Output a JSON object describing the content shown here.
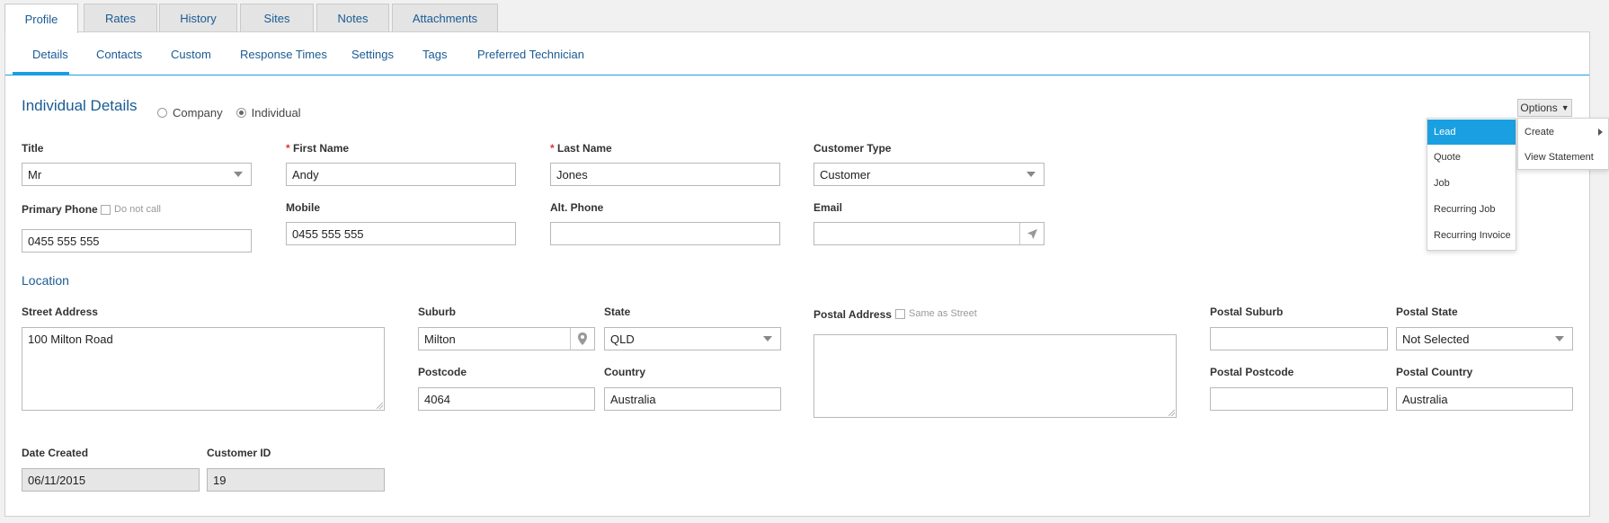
{
  "top_tabs": [
    {
      "label": "Profile"
    },
    {
      "label": "Rates"
    },
    {
      "label": "History"
    },
    {
      "label": "Sites"
    },
    {
      "label": "Notes"
    },
    {
      "label": "Attachments"
    }
  ],
  "sub_tabs": [
    {
      "label": "Details"
    },
    {
      "label": "Contacts"
    },
    {
      "label": "Custom"
    },
    {
      "label": "Response Times"
    },
    {
      "label": "Settings"
    },
    {
      "label": "Tags"
    },
    {
      "label": "Preferred Technician"
    }
  ],
  "details": {
    "title": "Individual Details",
    "type_company": "Company",
    "type_individual": "Individual",
    "selected_type": "Individual"
  },
  "fields": {
    "title_label": "Title",
    "title_value": "Mr",
    "first_name_label": "First Name",
    "first_name_value": "Andy",
    "last_name_label": "Last Name",
    "last_name_value": "Jones",
    "customer_type_label": "Customer Type",
    "customer_type_value": "Customer",
    "primary_phone_label": "Primary Phone",
    "do_not_call_label": "Do not call",
    "primary_phone_value": "0455 555 555",
    "mobile_label": "Mobile",
    "mobile_value": "0455 555 555",
    "alt_phone_label": "Alt. Phone",
    "alt_phone_value": "",
    "email_label": "Email",
    "email_value": "",
    "required_marker": "*"
  },
  "location": {
    "title": "Location",
    "street_label": "Street Address",
    "street_value": "100 Milton Road",
    "suburb_label": "Suburb",
    "suburb_value": "Milton",
    "state_label": "State",
    "state_value": "QLD",
    "postcode_label": "Postcode",
    "postcode_value": "4064",
    "country_label": "Country",
    "country_value": "Australia",
    "postal_address_label": "Postal Address",
    "same_as_street_label": "Same as Street",
    "postal_address_value": "",
    "postal_suburb_label": "Postal Suburb",
    "postal_suburb_value": "",
    "postal_state_label": "Postal State",
    "postal_state_value": "Not Selected",
    "postal_postcode_label": "Postal Postcode",
    "postal_postcode_value": "",
    "postal_country_label": "Postal Country",
    "postal_country_value": "Australia"
  },
  "meta": {
    "date_created_label": "Date Created",
    "date_created_value": "06/11/2015",
    "customer_id_label": "Customer ID",
    "customer_id_value": "19"
  },
  "options": {
    "button_label": "Options",
    "menu_items": [
      {
        "label": "Lead"
      },
      {
        "label": "Quote"
      },
      {
        "label": "Job"
      },
      {
        "label": "Recurring Job"
      },
      {
        "label": "Recurring Invoice"
      }
    ],
    "side_items": [
      {
        "label": "Create"
      },
      {
        "label": "View Statement"
      }
    ]
  },
  "colors": {
    "accent": "#1aa0e0",
    "link": "#1a5b93",
    "required": "#dd3333"
  },
  "icons": {
    "location_pin": "map-pin-icon",
    "send": "send-icon"
  }
}
